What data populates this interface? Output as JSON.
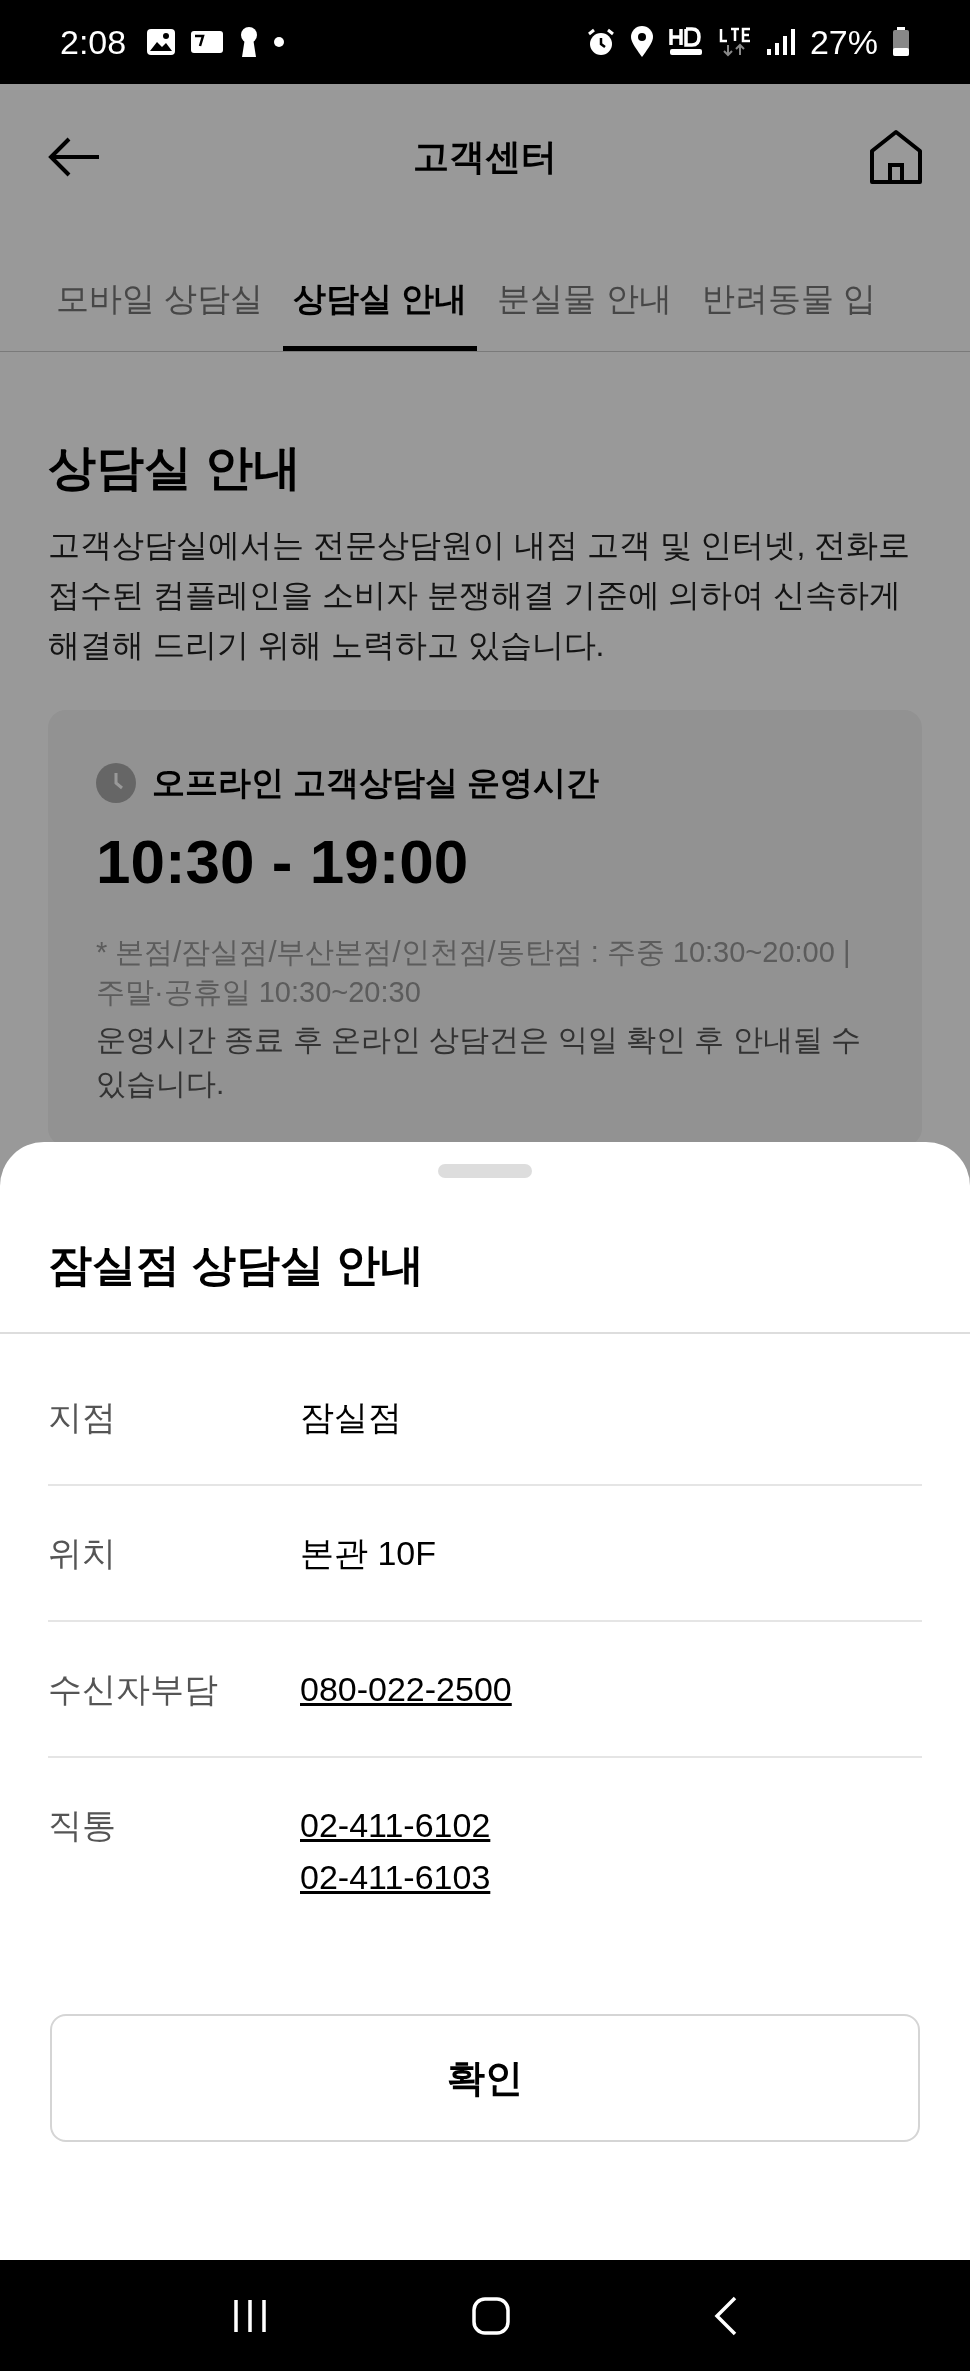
{
  "status_bar": {
    "time": "2:08",
    "battery": "27%"
  },
  "header": {
    "title": "고객센터"
  },
  "tabs": [
    {
      "label": "모바일 상담실",
      "selected": false
    },
    {
      "label": "상담실 안내",
      "selected": true
    },
    {
      "label": "분실물 안내",
      "selected": false
    },
    {
      "label": "반려동물 입",
      "selected": false
    }
  ],
  "page": {
    "heading": "상담실 안내",
    "intro": "고객상담실에서는 전문상담원이 내점 고객 및 인터넷, 전화로 접수된 컴플레인을 소비자 분쟁해결 기준에 의하여 신속하게 해결해 드리기 위해 노력하고 있습니다.",
    "hours_card": {
      "title": "오프라인 고객상담실 운영시간",
      "hours": "10:30 - 19:00",
      "note": "* 본점/잠실점/부산본점/인천점/동탄점 : 주중 10:30~20:00 | 주말·공휴일 10:30~20:30",
      "notice": "운영시간 종료 후 온라인 상담건은 익일 확인 후 안내될 수 있습니다."
    }
  },
  "sheet": {
    "title": "잠실점 상담실 안내",
    "rows": [
      {
        "label": "지점",
        "kind": "text",
        "values": [
          "잠실점"
        ]
      },
      {
        "label": "위치",
        "kind": "text",
        "values": [
          "본관 10F"
        ]
      },
      {
        "label": "수신자부담",
        "kind": "phone",
        "values": [
          "080-022-2500"
        ]
      },
      {
        "label": "직통",
        "kind": "phone",
        "values": [
          "02-411-6102",
          "02-411-6103"
        ]
      }
    ],
    "confirm_button": "확인"
  }
}
